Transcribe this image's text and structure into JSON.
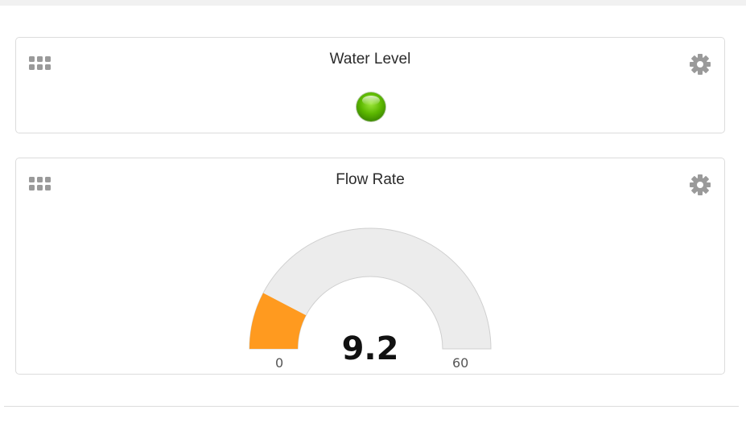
{
  "widgets": [
    {
      "title": "Water Level",
      "type": "led",
      "led_color": "#5cb800",
      "led_state": "on"
    },
    {
      "title": "Flow Rate",
      "type": "gauge",
      "value": "9.2",
      "min": "0",
      "max": "60",
      "fill_color": "#ff9a1f",
      "track_color": "#ececec"
    }
  ],
  "icons": {
    "drag_handle": "grip-dots-icon",
    "settings": "gear-icon"
  }
}
